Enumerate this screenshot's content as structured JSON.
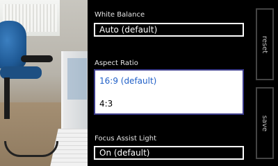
{
  "white_balance": {
    "label": "White Balance",
    "value": "Auto (default)"
  },
  "aspect_ratio": {
    "label": "Aspect Ratio",
    "options": [
      {
        "label": "16:9 (default)",
        "selected": true
      },
      {
        "label": "4:3",
        "selected": false
      }
    ]
  },
  "focus_assist": {
    "label": "Focus Assist Light",
    "value": "On (default)"
  },
  "app_bar": {
    "reset_label": "reset",
    "save_label": "save"
  },
  "colors": {
    "accent": "#1f5fc7",
    "background": "#000000",
    "listbox_border": "#3a3a8a"
  }
}
